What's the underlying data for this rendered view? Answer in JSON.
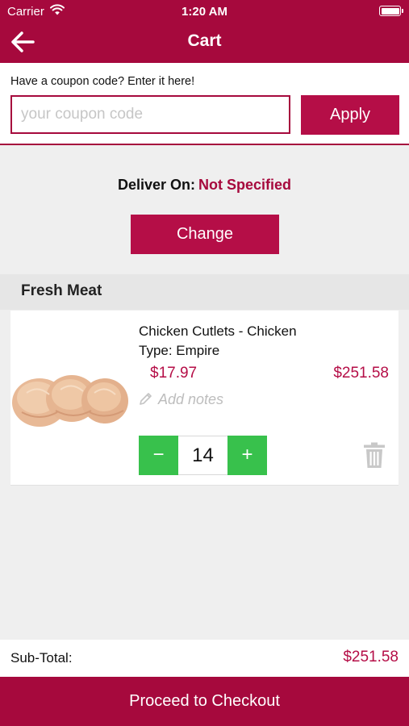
{
  "status_bar": {
    "carrier": "Carrier",
    "time": "1:20 AM"
  },
  "header": {
    "title": "Cart",
    "back_icon": "arrow-left-icon"
  },
  "coupon": {
    "prompt": "Have a coupon code? Enter it here!",
    "value": "",
    "placeholder": "your coupon code",
    "apply_label": "Apply"
  },
  "delivery": {
    "label": "Deliver On:",
    "value": "Not Specified",
    "change_label": "Change"
  },
  "section": {
    "title": "Fresh Meat"
  },
  "cart_item": {
    "name_line1": "Chicken Cutlets - Chicken",
    "name_line2": "Type: Empire",
    "unit_price": "$17.97",
    "line_total": "$251.58",
    "notes_placeholder": "Add notes",
    "quantity": "14",
    "decrement": "−",
    "increment": "+"
  },
  "subtotal": {
    "label": "Sub-Total:",
    "amount": "$251.58"
  },
  "checkout": {
    "label": "Proceed to Checkout"
  },
  "colors": {
    "brand": "#a6093d",
    "accent_green": "#38c14c",
    "price": "#b50e47"
  }
}
